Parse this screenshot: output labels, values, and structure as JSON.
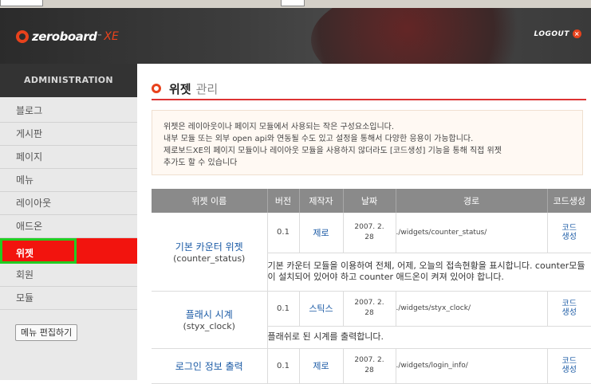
{
  "header": {
    "brand": "zeroboard",
    "brand_tm": "™",
    "brand_suffix": "XE",
    "logout": "LOGOUT"
  },
  "sidebar": {
    "title": "ADMINISTRATION",
    "items": [
      {
        "label": "블로그"
      },
      {
        "label": "게시판"
      },
      {
        "label": "페이지"
      },
      {
        "label": "메뉴"
      },
      {
        "label": "레이아웃"
      },
      {
        "label": "애드온"
      },
      {
        "label": "위젯"
      },
      {
        "label": "회원"
      },
      {
        "label": "모듈"
      }
    ],
    "active_index": 6,
    "edit_button": "메뉴 편집하기"
  },
  "page": {
    "title_main": "위젯",
    "title_sub": "관리",
    "description": [
      "위젯은 레이아웃이나 페이지 모듈에서 사용되는 작은 구성요소입니다.",
      "내부 모듈 또는 외부 open api와 연동될 수도 있고 설정을 통해서 다양한 응용이 가능합니다.",
      "제로보드XE의 페이지 모듈이나 레이아웃 모듈을 사용하지 않더라도 [코드생성] 기능을 통해 직접 위젯",
      "추가도 할 수 있습니다"
    ]
  },
  "table": {
    "headers": [
      "위젯 이름",
      "버전",
      "제작자",
      "날짜",
      "경로",
      "코드생성"
    ],
    "rows": [
      {
        "name": "기본 카운터 위젯",
        "id": "(counter_status)",
        "version": "0.1",
        "author": "제로",
        "date_line1": "2007. 2.",
        "date_line2": "28",
        "path": "./widgets/counter_status/",
        "code_line1": "코드",
        "code_line2": "생성",
        "description": "기본 카운터 모듈을 이용하여 전체, 어제, 오늘의 접속현황을 표시합니다. counter모듈이 설치되어 있어야 하고 counter 애드온이 켜져 있어야 합니다."
      },
      {
        "name": "플래시 시계",
        "id": "(styx_clock)",
        "version": "0.1",
        "author": "스틱스",
        "date_line1": "2007. 2.",
        "date_line2": "28",
        "path": "./widgets/styx_clock/",
        "code_line1": "코드",
        "code_line2": "생성",
        "description": "플래쉬로 된 시계를 출력합니다."
      },
      {
        "name": "로그인 정보 출력",
        "id": "",
        "version": "0.1",
        "author": "제로",
        "date_line1": "2007. 2.",
        "date_line2": "28",
        "path": "./widgets/login_info/",
        "code_line1": "코드",
        "code_line2": "생성",
        "description": ""
      }
    ]
  },
  "colors": {
    "accent": "#e8421c",
    "active_menu": "#f2140e",
    "highlight_border": "#22cc22",
    "link": "#1a5aa5",
    "table_header": "#8a8a8a"
  }
}
